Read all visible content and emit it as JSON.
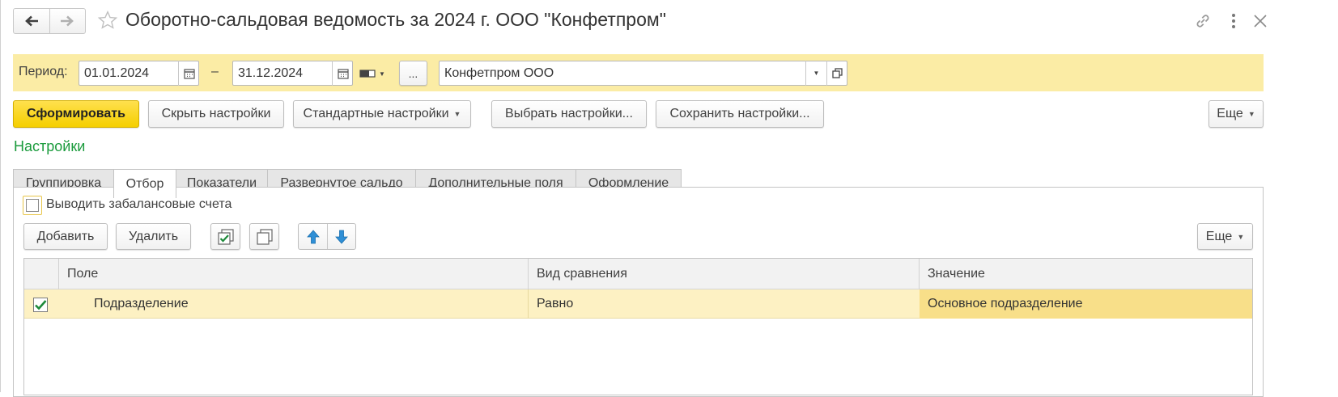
{
  "window": {
    "title": "Оборотно-сальдовая ведомость за 2024 г. ООО \"Конфетпром\"",
    "back_icon": "arrow-left-icon",
    "forward_icon": "arrow-right-icon",
    "favorite_icon": "star-icon",
    "link_icon": "link-icon",
    "menu_icon": "vertical-dots-icon",
    "close_icon": "close-icon"
  },
  "period": {
    "label": "Период:",
    "from": "01.01.2024",
    "dash": "–",
    "to": "31.12.2024",
    "more_button": "...",
    "organization": "Конфетпром ООО"
  },
  "toolbar": {
    "generate": "Сформировать",
    "hide_settings": "Скрыть настройки",
    "standard_settings": "Стандартные настройки",
    "choose_settings": "Выбрать настройки...",
    "save_settings": "Сохранить настройки...",
    "more": "Еще"
  },
  "settings": {
    "title": "Настройки",
    "tabs": [
      {
        "label": "Группировка"
      },
      {
        "label": "Отбор"
      },
      {
        "label": "Показатели"
      },
      {
        "label": "Развернутое сальдо"
      },
      {
        "label": "Дополнительные поля"
      },
      {
        "label": "Оформление"
      }
    ],
    "active_tab": "Отбор"
  },
  "filter": {
    "offbalance_label": "Выводить забалансовые счета",
    "offbalance_checked": false,
    "add": "Добавить",
    "delete": "Удалить",
    "more": "Еще",
    "columns": {
      "field": "Поле",
      "comparison": "Вид сравнения",
      "value": "Значение"
    },
    "rows": [
      {
        "checked": true,
        "field": "Подразделение",
        "comparison": "Равно",
        "value": "Основное подразделение"
      }
    ]
  },
  "colors": {
    "accent_yellow": "#f5cf00",
    "period_bar": "#fbeca5",
    "selected_row": "#fdf1c3",
    "selected_cell": "#f8df89",
    "settings_green": "#1a9b3c"
  }
}
